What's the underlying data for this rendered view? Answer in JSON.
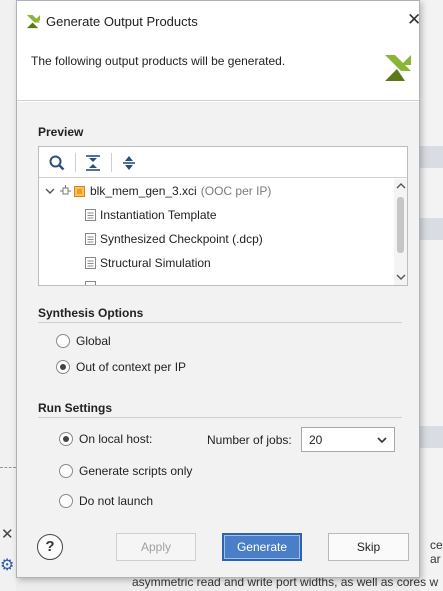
{
  "dialog": {
    "title": "Generate Output Products",
    "description": "The following output products will be generated."
  },
  "preview": {
    "section_title": "Preview",
    "toolbar_icons": [
      "search-icon",
      "collapse-all-icon",
      "expand-all-icon"
    ],
    "tree": {
      "root": {
        "label": "blk_mem_gen_3.xci",
        "suffix": "(OOC per IP)"
      },
      "children": [
        {
          "label": "Instantiation Template"
        },
        {
          "label": "Synthesized Checkpoint (.dcp)"
        },
        {
          "label": "Structural Simulation"
        }
      ]
    }
  },
  "synthesis": {
    "section_title": "Synthesis Options",
    "options": [
      {
        "label": "Global",
        "checked": false
      },
      {
        "label": "Out of context per IP",
        "checked": true
      }
    ]
  },
  "run": {
    "section_title": "Run Settings",
    "options": [
      {
        "label": "On local host:",
        "checked": true
      },
      {
        "label": "Generate scripts only",
        "checked": false
      },
      {
        "label": "Do not launch",
        "checked": false
      }
    ],
    "jobs_label": "Number of jobs:",
    "jobs_value": "20"
  },
  "footer": {
    "help_label": "?",
    "apply_label": "Apply",
    "generate_label": "Generate",
    "skip_label": "Skip"
  },
  "background": {
    "bottom_text": "asymmetric read and write port widths, as well as cores w",
    "right_text_1": "ce",
    "right_text_2": "ar"
  },
  "colors": {
    "accent": "#4a7fc7",
    "logo_green": "#8bb536",
    "logo_olive": "#5a7a1a"
  }
}
